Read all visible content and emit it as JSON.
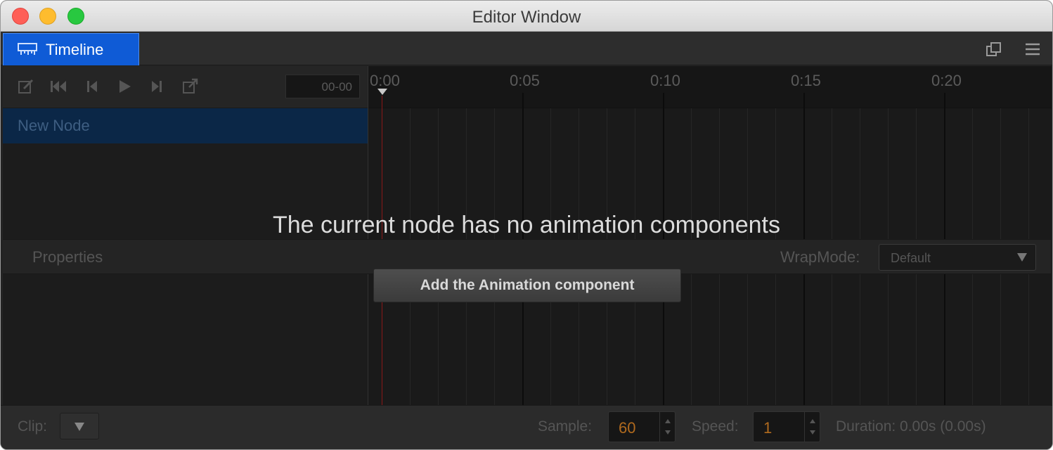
{
  "window": {
    "title": "Editor Window"
  },
  "tab": {
    "label": "Timeline",
    "icon": "timeline-icon",
    "color": "#0f5bd6"
  },
  "toolbar": {
    "icons": [
      "edit-icon",
      "jump-first-icon",
      "step-back-icon",
      "play-icon",
      "step-forward-icon",
      "open-external-icon"
    ],
    "time_value": "00-00"
  },
  "ruler": {
    "labels": [
      "0:00",
      "0:05",
      "0:10",
      "0:15",
      "0:20"
    ]
  },
  "node": {
    "name": "New Node"
  },
  "properties": {
    "label": "Properties",
    "wrap_label": "WrapMode:",
    "wrap_value": "Default"
  },
  "message": {
    "text": "The current node has no animation components",
    "button_label": "Add the Animation component"
  },
  "bottom": {
    "clip_label": "Clip:",
    "sample_label": "Sample:",
    "sample_value": "60",
    "speed_label": "Speed:",
    "speed_value": "1",
    "duration": "Duration: 0.00s (0.00s)"
  },
  "colors": {
    "accent": "#0f5bd6",
    "playhead": "#8a1717",
    "value": "#b06a1e"
  }
}
